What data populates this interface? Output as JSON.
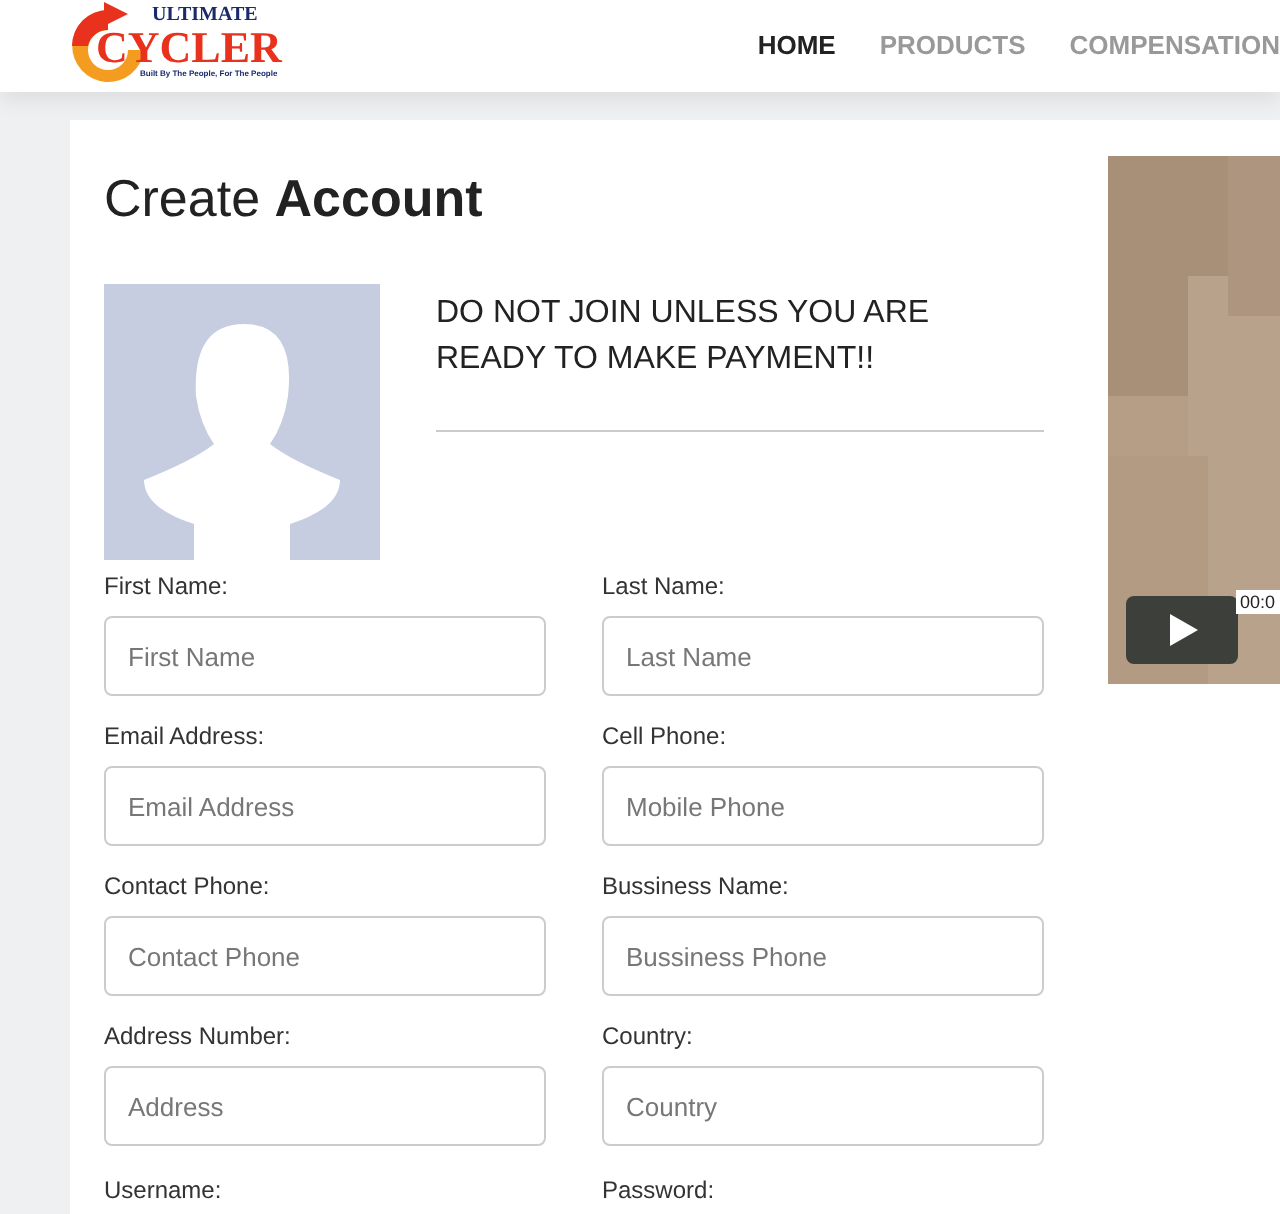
{
  "logo": {
    "top": "ULTIMATE",
    "name": "CYCLER",
    "tagline": "Built By The People, For The People"
  },
  "nav": [
    {
      "label": "HOME",
      "selected": true
    },
    {
      "label": "PRODUCTS",
      "selected": false
    },
    {
      "label": "COMPENSATION",
      "selected": false
    }
  ],
  "title": {
    "light": "Create",
    "bold": "Account"
  },
  "notice": "DO NOT JOIN UNLESS YOU ARE READY TO MAKE PAYMENT!!",
  "fields": [
    {
      "label": "First Name:",
      "placeholder": "First Name"
    },
    {
      "label": "Last Name:",
      "placeholder": "Last Name"
    },
    {
      "label": "Email Address:",
      "placeholder": "Email Address"
    },
    {
      "label": "Cell Phone:",
      "placeholder": "Mobile Phone"
    },
    {
      "label": "Contact Phone:",
      "placeholder": "Contact Phone"
    },
    {
      "label": "Bussiness Name:",
      "placeholder": "Bussiness Phone"
    },
    {
      "label": "Address Number:",
      "placeholder": "Address"
    },
    {
      "label": "Country:",
      "placeholder": "Country"
    }
  ],
  "cut_labels": [
    "Username:",
    "Password:"
  ],
  "video": {
    "kind": "picture",
    "time": "00:0"
  }
}
